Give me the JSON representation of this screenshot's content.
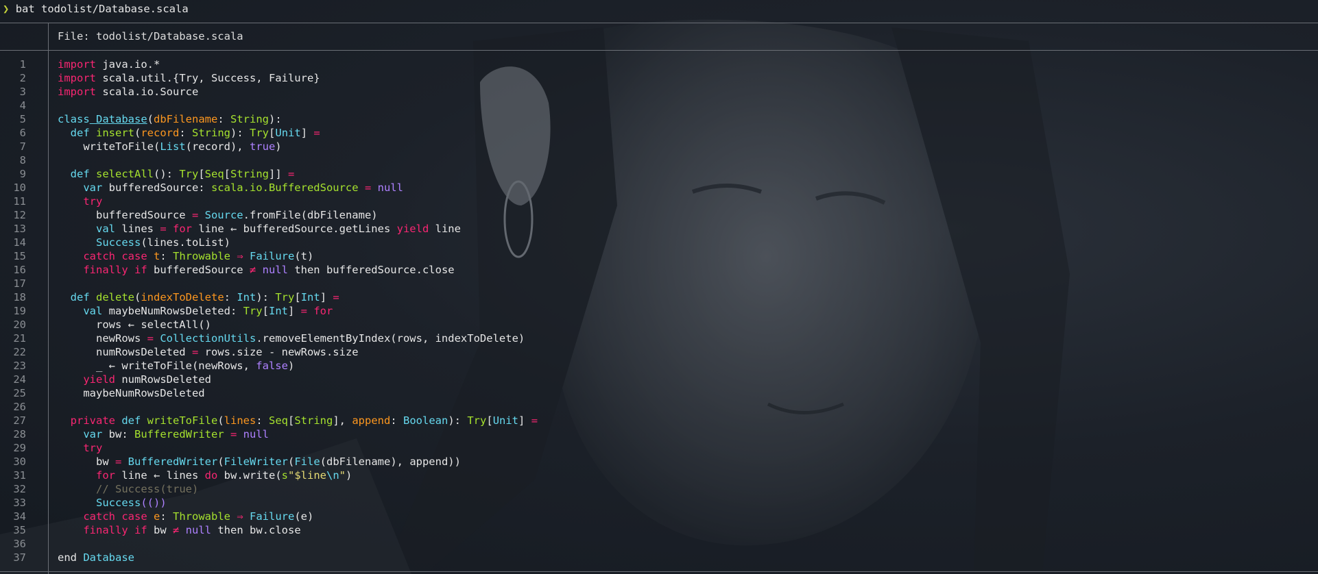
{
  "terminal": {
    "prompt_glyph": "❯",
    "command": "bat todolist/Database.scala",
    "file_header": "File: todolist/Database.scala"
  },
  "code_lines": [
    {
      "n": "1",
      "tokens": [
        [
          "kw",
          "import"
        ],
        [
          "",
          "  java.io.*"
        ]
      ]
    },
    {
      "n": "2",
      "tokens": [
        [
          "kw",
          "import"
        ],
        [
          "",
          "  scala.util.{Try, Success, Failure}"
        ]
      ]
    },
    {
      "n": "3",
      "tokens": [
        [
          "kw",
          "import"
        ],
        [
          "",
          "  scala.io.Source"
        ]
      ]
    },
    {
      "n": "4",
      "tokens": []
    },
    {
      "n": "5",
      "tokens": [
        [
          "ty",
          "class"
        ],
        [
          "ty ul",
          " Database"
        ],
        [
          "",
          "("
        ],
        [
          "pa",
          "dbFilename"
        ],
        [
          "",
          ": "
        ],
        [
          "fn",
          "String"
        ],
        [
          "",
          "):"
        ]
      ]
    },
    {
      "n": "6",
      "tokens": [
        [
          "",
          "  "
        ],
        [
          "ty",
          "def"
        ],
        [
          "",
          ""
        ],
        [
          "fn",
          " insert"
        ],
        [
          "",
          "("
        ],
        [
          "pa",
          "record"
        ],
        [
          "",
          ": "
        ],
        [
          "fn",
          "String"
        ],
        [
          "",
          "): "
        ],
        [
          "fn",
          "Try"
        ],
        [
          "",
          "["
        ],
        [
          "ty",
          "Unit"
        ],
        [
          "",
          "] "
        ],
        [
          "kw",
          "="
        ]
      ]
    },
    {
      "n": "7",
      "tokens": [
        [
          "",
          "    writeToFile("
        ],
        [
          "ty",
          "List"
        ],
        [
          "",
          "(record), "
        ],
        [
          "cn",
          "true"
        ],
        [
          "",
          ")"
        ]
      ]
    },
    {
      "n": "8",
      "tokens": []
    },
    {
      "n": "9",
      "tokens": [
        [
          "",
          "  "
        ],
        [
          "ty",
          "def"
        ],
        [
          "fn",
          " selectAll"
        ],
        [
          "",
          "(): "
        ],
        [
          "fn",
          "Try"
        ],
        [
          "",
          "["
        ],
        [
          "fn",
          "Seq"
        ],
        [
          "",
          "["
        ],
        [
          "fn",
          "String"
        ],
        [
          "",
          "]] "
        ],
        [
          "kw",
          "="
        ]
      ]
    },
    {
      "n": "10",
      "tokens": [
        [
          "",
          "    "
        ],
        [
          "ty",
          "var"
        ],
        [
          "",
          ""
        ],
        [
          "",
          ""
        ],
        [
          "",
          "  bufferedSource: "
        ],
        [
          "fn",
          "scala.io.BufferedSource"
        ],
        [
          "",
          ""
        ],
        [
          "kw",
          " ="
        ],
        [
          "cn",
          " null"
        ]
      ]
    },
    {
      "n": "11",
      "tokens": [
        [
          "",
          "    "
        ],
        [
          "kw",
          "try"
        ]
      ]
    },
    {
      "n": "12",
      "tokens": [
        [
          "",
          "      bufferedSource "
        ],
        [
          "kw",
          "="
        ],
        [
          "ty",
          " Source"
        ],
        [
          "",
          ".fromFile(dbFilename)"
        ]
      ]
    },
    {
      "n": "13",
      "tokens": [
        [
          "",
          "      "
        ],
        [
          "ty",
          "val"
        ],
        [
          "",
          ""
        ],
        [
          "",
          "  lines "
        ],
        [
          "kw",
          "="
        ],
        [
          "kw",
          " for"
        ],
        [
          "",
          ""
        ],
        [
          "",
          "  line ← bufferedSource.getLines "
        ],
        [
          "kw",
          "yield"
        ],
        [
          "",
          ""
        ],
        [
          "",
          "  line"
        ]
      ]
    },
    {
      "n": "14",
      "tokens": [
        [
          "",
          "      "
        ],
        [
          "ty",
          "Success"
        ],
        [
          "",
          "(lines.toList)"
        ]
      ]
    },
    {
      "n": "15",
      "tokens": [
        [
          "",
          "    "
        ],
        [
          "kw",
          "catch case"
        ],
        [
          "",
          ""
        ],
        [
          "pa",
          " t"
        ],
        [
          "",
          ": "
        ],
        [
          "fn",
          "Throwable"
        ],
        [
          "kw",
          " ⇒"
        ],
        [
          "ty",
          " Failure"
        ],
        [
          "",
          "(t)"
        ]
      ]
    },
    {
      "n": "16",
      "tokens": [
        [
          "",
          "    "
        ],
        [
          "kw",
          "finally if"
        ],
        [
          "",
          ""
        ],
        [
          "",
          "  bufferedSource "
        ],
        [
          "kw",
          "≠"
        ],
        [
          "cn",
          " null"
        ],
        [
          "",
          ""
        ],
        [
          "",
          "  then bufferedSource.close"
        ]
      ]
    },
    {
      "n": "17",
      "tokens": []
    },
    {
      "n": "18",
      "tokens": [
        [
          "",
          "  "
        ],
        [
          "ty",
          "def"
        ],
        [
          "fn",
          " delete"
        ],
        [
          "",
          "("
        ],
        [
          "pa",
          "indexToDelete"
        ],
        [
          "",
          ": "
        ],
        [
          "ty",
          "Int"
        ],
        [
          "",
          "): "
        ],
        [
          "fn",
          "Try"
        ],
        [
          "",
          "["
        ],
        [
          "ty",
          "Int"
        ],
        [
          "",
          "] "
        ],
        [
          "kw",
          "="
        ]
      ]
    },
    {
      "n": "19",
      "tokens": [
        [
          "",
          "    "
        ],
        [
          "ty",
          "val"
        ],
        [
          "",
          ""
        ],
        [
          "",
          "  maybeNumRowsDeleted: "
        ],
        [
          "fn",
          "Try"
        ],
        [
          "",
          "["
        ],
        [
          "ty",
          "Int"
        ],
        [
          "",
          "] "
        ],
        [
          "kw",
          "="
        ],
        [
          "kw",
          " for"
        ]
      ]
    },
    {
      "n": "20",
      "tokens": [
        [
          "",
          "      rows ← selectAll()"
        ]
      ]
    },
    {
      "n": "21",
      "tokens": [
        [
          "",
          "      newRows "
        ],
        [
          "kw",
          "="
        ],
        [
          "ty",
          " CollectionUtils"
        ],
        [
          "",
          ".removeElementByIndex(rows, indexToDelete)"
        ]
      ]
    },
    {
      "n": "22",
      "tokens": [
        [
          "",
          "      numRowsDeleted "
        ],
        [
          "kw",
          "="
        ],
        [
          "",
          ""
        ],
        [
          "",
          "  rows.size - newRows.size"
        ]
      ]
    },
    {
      "n": "23",
      "tokens": [
        [
          "",
          "      _ ← writeToFile(newRows, "
        ],
        [
          "cn",
          "false"
        ],
        [
          "",
          ")"
        ]
      ]
    },
    {
      "n": "24",
      "tokens": [
        [
          "",
          "    "
        ],
        [
          "kw",
          "yield"
        ],
        [
          "",
          ""
        ],
        [
          "",
          "  numRowsDeleted"
        ]
      ]
    },
    {
      "n": "25",
      "tokens": [
        [
          "",
          "    maybeNumRowsDeleted"
        ]
      ]
    },
    {
      "n": "26",
      "tokens": []
    },
    {
      "n": "27",
      "tokens": [
        [
          "",
          "  "
        ],
        [
          "kw",
          "private"
        ],
        [
          "ty",
          " def"
        ],
        [
          "fn",
          " writeToFile"
        ],
        [
          "",
          "("
        ],
        [
          "pa",
          "lines"
        ],
        [
          "",
          ": "
        ],
        [
          "fn",
          "Seq"
        ],
        [
          "",
          "["
        ],
        [
          "fn",
          "String"
        ],
        [
          "",
          "], "
        ],
        [
          "pa",
          "append"
        ],
        [
          "",
          ": "
        ],
        [
          "ty",
          "Boolean"
        ],
        [
          "",
          "): "
        ],
        [
          "fn",
          "Try"
        ],
        [
          "",
          "["
        ],
        [
          "ty",
          "Unit"
        ],
        [
          "",
          "] "
        ],
        [
          "kw",
          "="
        ]
      ]
    },
    {
      "n": "28",
      "tokens": [
        [
          "",
          "    "
        ],
        [
          "ty",
          "var"
        ],
        [
          "",
          ""
        ],
        [
          "",
          "  bw: "
        ],
        [
          "fn",
          "BufferedWriter"
        ],
        [
          "kw",
          " ="
        ],
        [
          "cn",
          " null"
        ]
      ]
    },
    {
      "n": "29",
      "tokens": [
        [
          "",
          "    "
        ],
        [
          "kw",
          "try"
        ]
      ]
    },
    {
      "n": "30",
      "tokens": [
        [
          "",
          "      bw "
        ],
        [
          "kw",
          "="
        ],
        [
          "ty",
          " BufferedWriter"
        ],
        [
          "",
          "("
        ],
        [
          "ty",
          "FileWriter"
        ],
        [
          "",
          "("
        ],
        [
          "ty",
          "File"
        ],
        [
          "",
          "(dbFilename), append))"
        ]
      ]
    },
    {
      "n": "31",
      "tokens": [
        [
          "",
          "      "
        ],
        [
          "kw",
          "for"
        ],
        [
          "",
          ""
        ],
        [
          "",
          "  line ← lines "
        ],
        [
          "kw",
          "do"
        ],
        [
          "",
          ""
        ],
        [
          "",
          "  bw.write("
        ],
        [
          "fn",
          "s"
        ],
        [
          "st",
          "\"$line"
        ],
        [
          "ty",
          "\\n"
        ],
        [
          "st",
          "\""
        ],
        [
          "",
          ")"
        ]
      ]
    },
    {
      "n": "32",
      "tokens": [
        [
          "",
          "      "
        ],
        [
          "cm",
          "// Success(true)"
        ]
      ]
    },
    {
      "n": "33",
      "tokens": [
        [
          "",
          "      "
        ],
        [
          "ty",
          "Success"
        ],
        [
          "",
          ""
        ],
        [
          "cn",
          "(())"
        ]
      ]
    },
    {
      "n": "34",
      "tokens": [
        [
          "",
          "    "
        ],
        [
          "kw",
          "catch case"
        ],
        [
          "pa",
          " e"
        ],
        [
          "",
          ": "
        ],
        [
          "fn",
          "Throwable"
        ],
        [
          "kw",
          " ⇒"
        ],
        [
          "ty",
          " Failure"
        ],
        [
          "",
          "(e)"
        ]
      ]
    },
    {
      "n": "35",
      "tokens": [
        [
          "",
          "    "
        ],
        [
          "kw",
          "finally if"
        ],
        [
          "",
          ""
        ],
        [
          "",
          "  bw "
        ],
        [
          "kw",
          "≠"
        ],
        [
          "cn",
          " null"
        ],
        [
          "",
          ""
        ],
        [
          "",
          "  then bw.close"
        ]
      ]
    },
    {
      "n": "36",
      "tokens": []
    },
    {
      "n": "37",
      "tokens": [
        [
          "",
          "end "
        ],
        [
          "ty",
          "Database"
        ]
      ]
    }
  ]
}
